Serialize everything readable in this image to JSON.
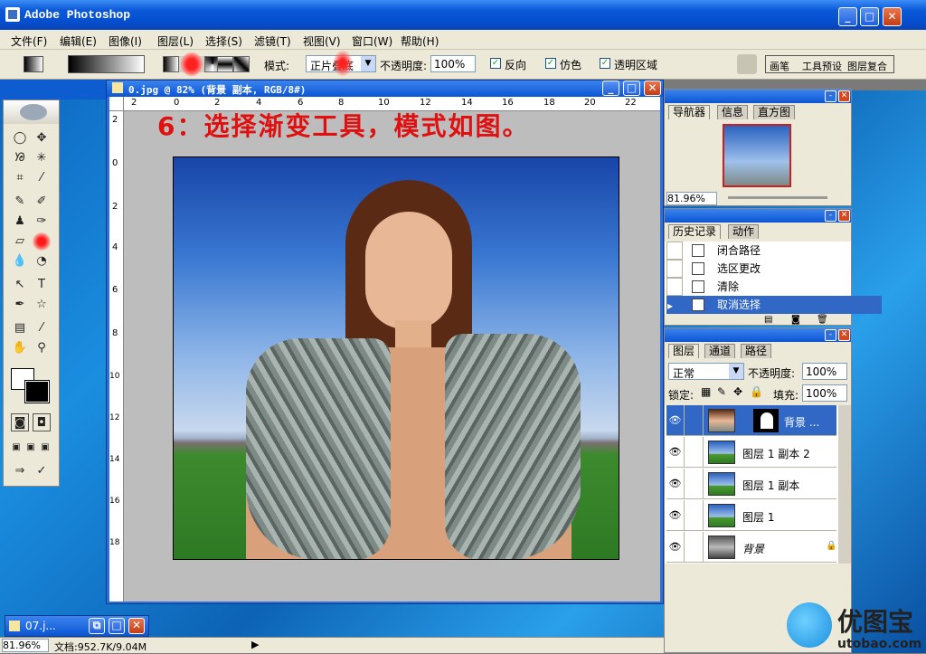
{
  "app": {
    "title": "Adobe Photoshop"
  },
  "menu": [
    "文件(F)",
    "编辑(E)",
    "图像(I)",
    "图层(L)",
    "选择(S)",
    "滤镜(T)",
    "视图(V)",
    "窗口(W)",
    "帮助(H)"
  ],
  "options": {
    "mode_label": "模式:",
    "mode_value": "正片叠底",
    "opacity_label": "不透明度:",
    "opacity_value": "100%",
    "reverse": "反向",
    "dither": "仿色",
    "transparency": "透明区域",
    "palette_tabs": [
      "画笔",
      "工具预设",
      "图层复合"
    ]
  },
  "document": {
    "title": "0.jpg @ 82% (背景 副本, RGB/8#)",
    "ruler_h": [
      "2",
      "0",
      "2",
      "4",
      "6",
      "8",
      "10",
      "12",
      "14",
      "16",
      "18",
      "20",
      "22"
    ],
    "ruler_v": [
      "2",
      "0",
      "2",
      "4",
      "6",
      "8",
      "10",
      "12",
      "14",
      "16",
      "18"
    ],
    "annotation": "6：选择渐变工具，模式如图。"
  },
  "navigator": {
    "tabs": [
      "导航器",
      "信息",
      "直方图"
    ],
    "zoom": "81.96%"
  },
  "history": {
    "tabs": [
      "历史记录",
      "动作"
    ],
    "items": [
      "闭合路径",
      "选区更改",
      "清除",
      "取消选择"
    ],
    "selected_index": 3
  },
  "layers": {
    "tabs": [
      "图层",
      "通道",
      "路径"
    ],
    "blend": "正常",
    "opacity_label": "不透明度:",
    "opacity_value": "100%",
    "lock_label": "锁定:",
    "fill_label": "填充:",
    "fill_value": "100%",
    "items": [
      "背景 ...",
      "图层 1 副本 2",
      "图层 1 副本",
      "图层 1",
      "背景"
    ]
  },
  "status": {
    "zoom": "81.96%",
    "doc": "文档:952.7K/9.04M"
  },
  "minimized": {
    "title": "07.j..."
  },
  "watermark": {
    "brand": "优图宝",
    "url": "utobao.com"
  }
}
